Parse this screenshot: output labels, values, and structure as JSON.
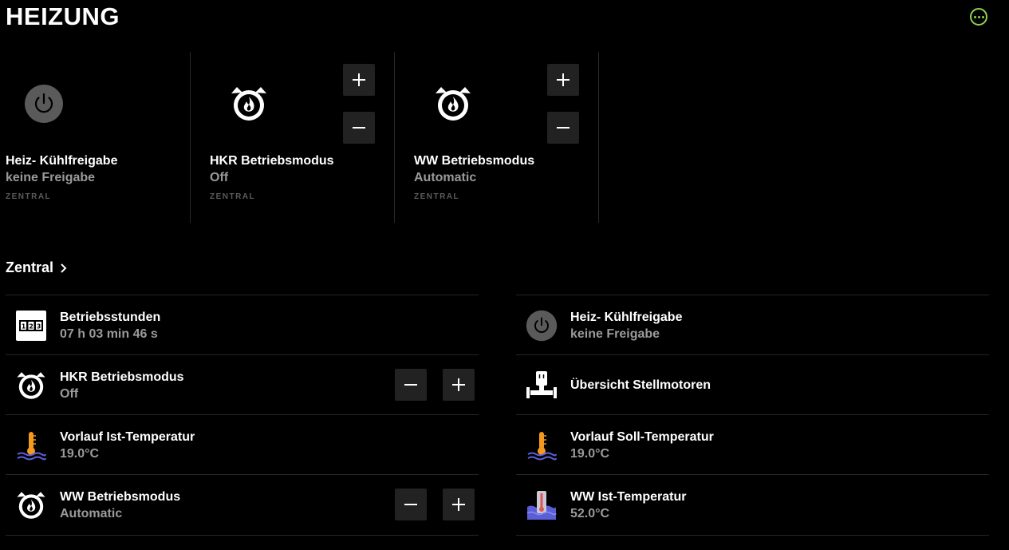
{
  "page": {
    "title": "HEIZUNG"
  },
  "colors": {
    "accent": "#8fd14f",
    "muted": "#9a9a9a",
    "button_bg": "#222222",
    "thermo_orange": "#f39a1e",
    "water_blue": "#5a5fd8"
  },
  "tiles": [
    {
      "name": "Heiz- Kühlfreigabe",
      "value": "keine Freigabe",
      "room": "ZENTRAL",
      "icon": "power-icon"
    },
    {
      "name": "HKR Betriebsmodus",
      "value": "Off",
      "room": "ZENTRAL",
      "icon": "heating-mode-icon"
    },
    {
      "name": "WW Betriebsmodus",
      "value": "Automatic",
      "room": "ZENTRAL",
      "icon": "heating-mode-icon"
    }
  ],
  "section": {
    "title": "Zentral"
  },
  "left_list": [
    {
      "name": "Betriebsstunden",
      "value": "07 h 03 min 46 s",
      "icon": "counter-icon"
    },
    {
      "name": "HKR Betriebsmodus",
      "value": "Off",
      "icon": "heating-mode-icon"
    },
    {
      "name": "Vorlauf Ist-Temperatur",
      "value": "19.0°C",
      "icon": "water-thermometer-icon"
    },
    {
      "name": "WW Betriebsmodus",
      "value": "Automatic",
      "icon": "heating-mode-icon"
    }
  ],
  "right_list": [
    {
      "name": "Heiz- Kühlfreigabe",
      "value": "keine Freigabe",
      "icon": "power-icon"
    },
    {
      "name": "Übersicht Stellmotoren",
      "value": "",
      "icon": "valve-actuator-icon"
    },
    {
      "name": "Vorlauf Soll-Temperatur",
      "value": "19.0°C",
      "icon": "water-thermometer-icon"
    },
    {
      "name": "WW Ist-Temperatur",
      "value": "52.0°C",
      "icon": "tank-thermometer-icon"
    }
  ]
}
